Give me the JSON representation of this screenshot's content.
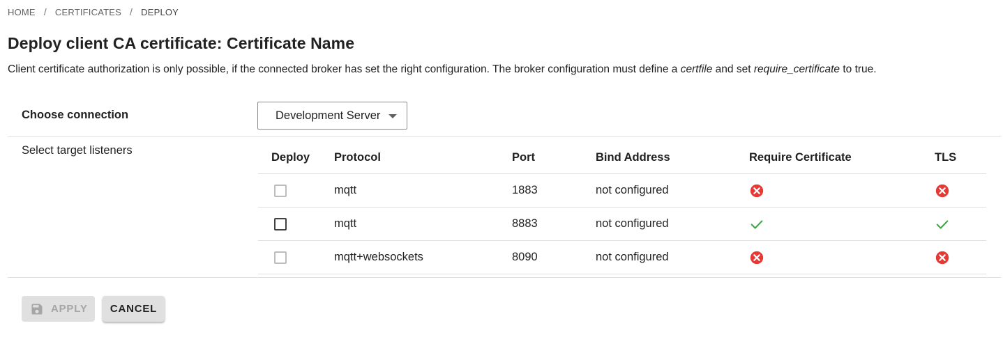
{
  "breadcrumb": {
    "items": [
      "HOME",
      "CERTIFICATES",
      "DEPLOY"
    ],
    "separator": "/"
  },
  "page": {
    "title": "Deploy client CA certificate: Certificate Name",
    "description_part1": "Client certificate authorization is only possible, if the connected broker has set the right configuration. The broker configuration must define a ",
    "description_em1": "certfile",
    "description_part2": " and set ",
    "description_em2": "require_certificate",
    "description_part3": " to true."
  },
  "connection": {
    "label": "Choose connection",
    "selected": "Development Server"
  },
  "listeners": {
    "label": "Select target listeners",
    "columns": [
      "Deploy",
      "Protocol",
      "Port",
      "Bind Address",
      "Require Certificate",
      "TLS"
    ],
    "rows": [
      {
        "deploy": false,
        "deploy_enabled": false,
        "protocol": "mqtt",
        "port": "1883",
        "bind_address": "not configured",
        "require_certificate": "error-icon",
        "tls": "error-icon"
      },
      {
        "deploy": false,
        "deploy_enabled": true,
        "protocol": "mqtt",
        "port": "8883",
        "bind_address": "not configured",
        "require_certificate": "check-icon",
        "tls": "check-icon"
      },
      {
        "deploy": false,
        "deploy_enabled": false,
        "protocol": "mqtt+websockets",
        "port": "8090",
        "bind_address": "not configured",
        "require_certificate": "error-icon",
        "tls": "error-icon"
      }
    ]
  },
  "actions": {
    "apply_label": "APPLY",
    "apply_icon": "save-icon",
    "apply_disabled": true,
    "cancel_label": "CANCEL"
  },
  "colors": {
    "error": "#e53935",
    "success": "#43a047",
    "text": "#212121",
    "muted": "#616161",
    "divider": "#e0e0e0"
  }
}
